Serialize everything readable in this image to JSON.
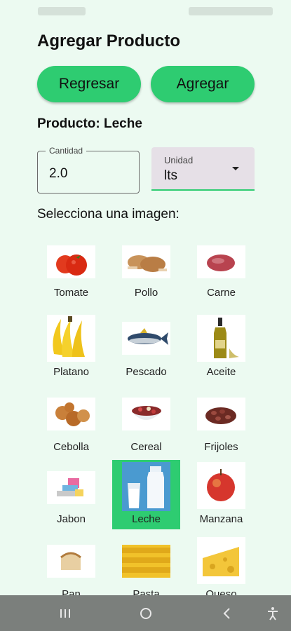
{
  "screen": {
    "title": "Agregar Producto"
  },
  "actions": {
    "back_label": "Regresar",
    "add_label": "Agregar"
  },
  "product": {
    "label": "Producto: Leche"
  },
  "quantity": {
    "label": "Cantidad",
    "value": "2.0"
  },
  "unit": {
    "label": "Unidad",
    "value": "lts"
  },
  "images": {
    "heading": "Selecciona una imagen:",
    "selected": "Leche",
    "items": [
      {
        "label": "Tomate",
        "icon": "tomato-image"
      },
      {
        "label": "Pollo",
        "icon": "chicken-image"
      },
      {
        "label": "Carne",
        "icon": "meat-image"
      },
      {
        "label": "Platano",
        "icon": "banana-image"
      },
      {
        "label": "Pescado",
        "icon": "fish-image"
      },
      {
        "label": "Aceite",
        "icon": "oil-bottle-image"
      },
      {
        "label": "Cebolla",
        "icon": "onion-image"
      },
      {
        "label": "Cereal",
        "icon": "cereal-image"
      },
      {
        "label": "Frijoles",
        "icon": "beans-image"
      },
      {
        "label": "Jabon",
        "icon": "soap-image"
      },
      {
        "label": "Leche",
        "icon": "milk-image"
      },
      {
        "label": "Manzana",
        "icon": "apple-image"
      },
      {
        "label": "Pan",
        "icon": "bread-image"
      },
      {
        "label": "Pasta",
        "icon": "pasta-image"
      },
      {
        "label": "Queso",
        "icon": "cheese-image"
      }
    ]
  },
  "colors": {
    "background": "#ecfaf1",
    "accent": "#2ecc71",
    "navbar": "#7b7f7c"
  }
}
